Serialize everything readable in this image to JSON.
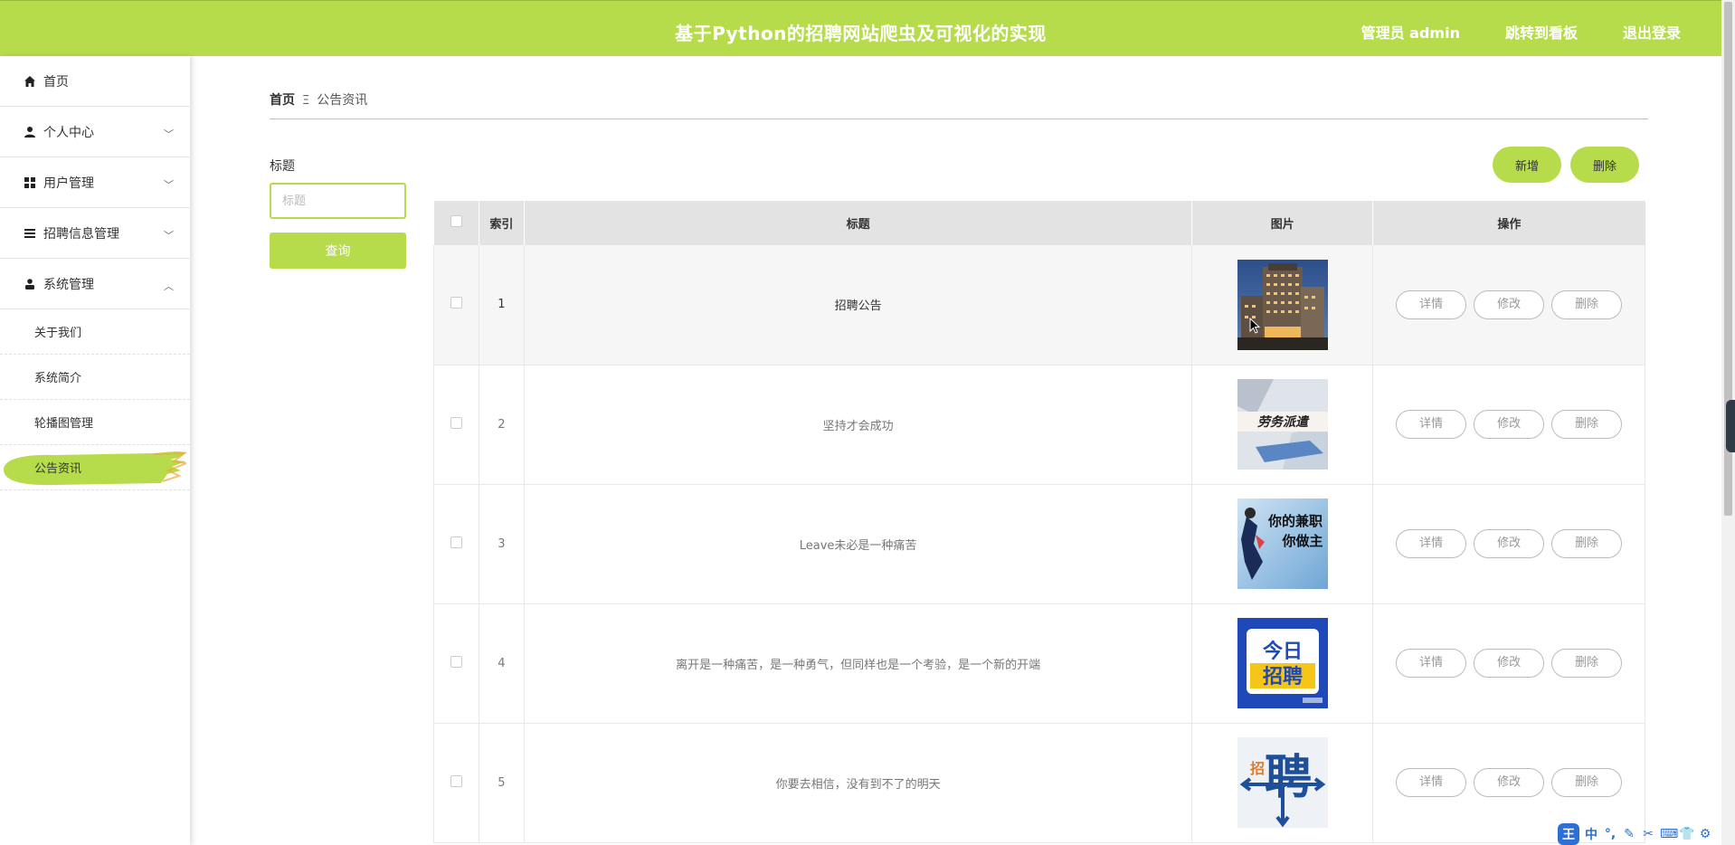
{
  "header": {
    "title": "基于Python的招聘网站爬虫及可视化的实现",
    "admin": "管理员 admin",
    "dashboard": "跳转到看板",
    "logout": "退出登录"
  },
  "sidebar": {
    "items": [
      {
        "label": "首页",
        "icon": "home-icon"
      },
      {
        "label": "个人中心",
        "icon": "user-icon"
      },
      {
        "label": "用户管理",
        "icon": "grid-icon"
      },
      {
        "label": "招聘信息管理",
        "icon": "list-icon"
      },
      {
        "label": "系统管理",
        "icon": "person-icon"
      }
    ],
    "subitems": [
      "关于我们",
      "系统简介",
      "轮播图管理",
      "公告资讯"
    ]
  },
  "breadcrumb": {
    "home": "首页",
    "sep": "Ξ",
    "current": "公告资讯"
  },
  "search": {
    "label": "标题",
    "placeholder": "标题",
    "button": "查询"
  },
  "actions": {
    "add": "新增",
    "delete": "删除"
  },
  "table": {
    "headers": [
      "索引",
      "标题",
      "图片",
      "操作"
    ],
    "ops": [
      "详情",
      "修改",
      "删除"
    ],
    "rows": [
      {
        "index": "1",
        "title": "招聘公告",
        "image": "hotel-building-photo"
      },
      {
        "index": "2",
        "title": "坚持才会成功",
        "image": "labor-dispatch-photo",
        "image_text": "劳务派遣"
      },
      {
        "index": "3",
        "title": "Leave未必是一种痛苦",
        "image": "part-time-poster",
        "image_text": "你的兼职 你做主"
      },
      {
        "index": "4",
        "title": "离开是一种痛苦，是一种勇气，但同样也是一个考验，是一个新的开端",
        "image": "today-recruit-poster",
        "image_text": "今日 招聘"
      },
      {
        "index": "5",
        "title": "你要去相信，没有到不了的明天",
        "image": "recruit-character-logo",
        "image_text": "招 聘"
      }
    ]
  },
  "ime": {
    "logo": "王",
    "mode": "中"
  },
  "colors": {
    "accent": "#b6dc4b",
    "header_bg": "#b6dc4b"
  }
}
